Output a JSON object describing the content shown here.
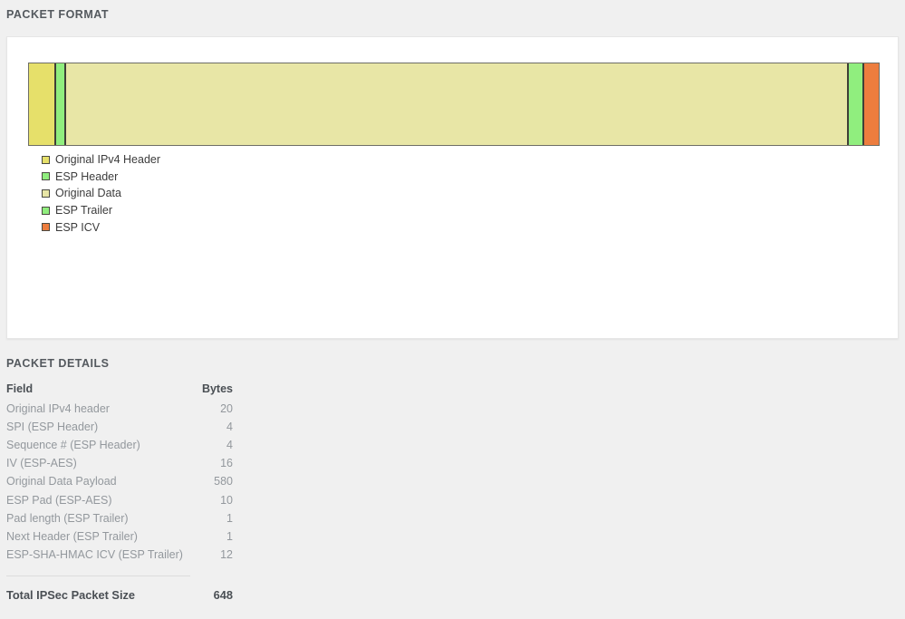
{
  "sections": {
    "packet_format_title": "PACKET FORMAT",
    "packet_details_title": "PACKET DETAILS"
  },
  "colors": {
    "original_ipv4_header": "#e6e06a",
    "esp_header": "#90ee7e",
    "original_data": "#e8e6a6",
    "esp_trailer": "#90ee7e",
    "esp_icv": "#ed7d3e",
    "background": "#f0f0f0",
    "card": "#ffffff",
    "segment_border": "#3f3f37"
  },
  "chart_data": {
    "type": "bar",
    "orientation": "horizontal-stacked",
    "title": "PACKET FORMAT",
    "xlabel": "",
    "ylabel": "",
    "legend_position": "below-left",
    "categories": [
      "Original IPv4 Header",
      "ESP Header",
      "Original Data",
      "ESP Trailer",
      "ESP ICV"
    ],
    "values": [
      20,
      8,
      606,
      12,
      12
    ],
    "unit": "Bytes",
    "total": 648,
    "series": [
      {
        "name": "IPSec Packet",
        "segments": [
          {
            "label": "Original IPv4 Header",
            "bytes": 20,
            "color": "#e6e06a"
          },
          {
            "label": "ESP Header",
            "bytes": 8,
            "color": "#90ee7e"
          },
          {
            "label": "Original Data",
            "bytes": 606,
            "color": "#e8e6a6"
          },
          {
            "label": "ESP Trailer",
            "bytes": 12,
            "color": "#90ee7e"
          },
          {
            "label": "ESP ICV",
            "bytes": 12,
            "color": "#ed7d3e"
          }
        ]
      }
    ]
  },
  "legend": [
    {
      "label": "Original IPv4 Header",
      "color": "#e6e06a"
    },
    {
      "label": "ESP Header",
      "color": "#90ee7e"
    },
    {
      "label": "Original Data",
      "color": "#e8e6a6"
    },
    {
      "label": "ESP Trailer",
      "color": "#90ee7e"
    },
    {
      "label": "ESP ICV",
      "color": "#ed7d3e"
    }
  ],
  "details": {
    "headers": {
      "field": "Field",
      "bytes": "Bytes"
    },
    "rows": [
      {
        "field": "Original IPv4 header",
        "bytes": "20"
      },
      {
        "field": "SPI (ESP Header)",
        "bytes": "4"
      },
      {
        "field": "Sequence # (ESP Header)",
        "bytes": "4"
      },
      {
        "field": "IV (ESP-AES)",
        "bytes": "16"
      },
      {
        "field": "Original Data Payload",
        "bytes": "580"
      },
      {
        "field": "ESP Pad (ESP-AES)",
        "bytes": "10"
      },
      {
        "field": "Pad length (ESP Trailer)",
        "bytes": "1"
      },
      {
        "field": "Next Header (ESP Trailer)",
        "bytes": "1"
      },
      {
        "field": "ESP-SHA-HMAC ICV (ESP Trailer)",
        "bytes": "12"
      }
    ],
    "total": {
      "label": "Total IPSec Packet Size",
      "bytes": "648"
    }
  }
}
